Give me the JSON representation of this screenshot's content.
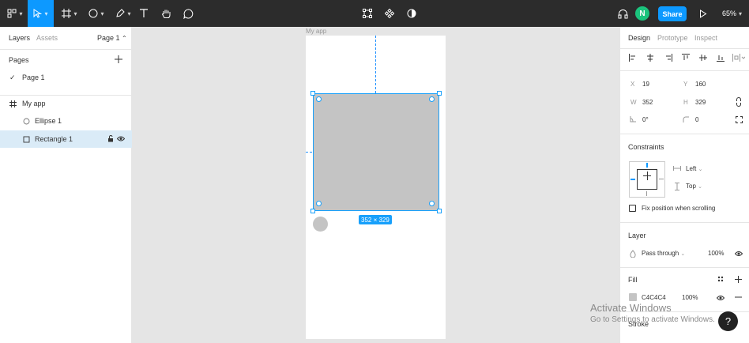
{
  "toolbar": {
    "share_label": "Share",
    "zoom": "65%",
    "avatar_initial": "N"
  },
  "left_panel": {
    "tabs": [
      "Layers",
      "Assets"
    ],
    "page_selector": "Page 1",
    "pages_title": "Pages",
    "pages": [
      {
        "label": "Page 1",
        "current": true
      }
    ],
    "layers": [
      {
        "label": "My app",
        "type": "frame"
      },
      {
        "label": "Ellipse 1",
        "type": "ellipse"
      },
      {
        "label": "Rectangle 1",
        "type": "rectangle",
        "selected": true
      }
    ]
  },
  "canvas": {
    "frame_label": "My app",
    "size_badge": "352 × 329"
  },
  "right_panel": {
    "tabs": [
      "Design",
      "Prototype",
      "Inspect"
    ],
    "x_label": "X",
    "x_value": "19",
    "y_label": "Y",
    "y_value": "160",
    "w_label": "W",
    "w_value": "352",
    "h_label": "H",
    "h_value": "329",
    "rotation": "0°",
    "radius": "0",
    "constraints_title": "Constraints",
    "horizontal_constraint": "Left",
    "vertical_constraint": "Top",
    "fix_position_label": "Fix position when scrolling",
    "layer_title": "Layer",
    "blend_mode": "Pass through",
    "layer_opacity": "100%",
    "fill_title": "Fill",
    "fill_hex": "C4C4C4",
    "fill_opacity": "100%",
    "stroke_title": "Stroke"
  },
  "overlay": {
    "activate_title": "Activate Windows",
    "activate_subtitle": "Go to Settings to activate Windows.",
    "help": "?"
  },
  "colors": {
    "toolbar_bg": "#2c2c2c",
    "accent": "#0d99ff",
    "fill": "#c4c4c4",
    "avatar": "#1bc47d",
    "selection_row": "#daebf7"
  }
}
